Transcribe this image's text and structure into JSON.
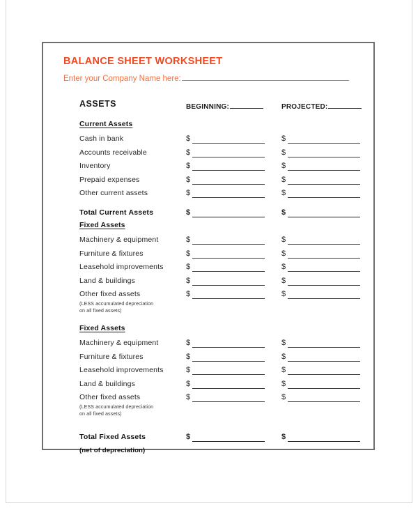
{
  "document": {
    "title": "BALANCE SHEET WORKSHEET",
    "company_prompt": "Enter your Company Name here:",
    "section_heading": "ASSETS",
    "accent_color": "#ef4a23",
    "subtitle_color": "#f4713f"
  },
  "columns": [
    {
      "id": "beginning",
      "label": "BEGINNING:"
    },
    {
      "id": "projected",
      "label": "PROJECTED:"
    }
  ],
  "currency_symbol": "$",
  "groups": [
    {
      "id": "current-assets",
      "title": "Current Assets",
      "rows": [
        {
          "label": "Cash in bank",
          "total": false
        },
        {
          "label": "Accounts receivable",
          "total": false
        },
        {
          "label": "Inventory",
          "total": false
        },
        {
          "label": "Prepaid expenses",
          "total": false
        },
        {
          "label": "Other current assets",
          "total": false
        },
        {
          "label": "Total Current Assets",
          "total": true
        }
      ]
    },
    {
      "id": "fixed-assets-1",
      "title": "Fixed Assets",
      "rows": [
        {
          "label": "Machinery & equipment",
          "total": false
        },
        {
          "label": "Furniture & fixtures",
          "total": false
        },
        {
          "label": "Leasehold improvements",
          "total": false
        },
        {
          "label": "Land & buildings",
          "total": false
        },
        {
          "label": "Other fixed assets",
          "total": false
        }
      ],
      "note_line_1": "(LESS accumulated depreciation",
      "note_line_2": "on all fixed assets)"
    },
    {
      "id": "fixed-assets-2",
      "title": "Fixed Assets",
      "rows": [
        {
          "label": "Machinery & equipment",
          "total": false
        },
        {
          "label": "Furniture & fixtures",
          "total": false
        },
        {
          "label": "Leasehold improvements",
          "total": false
        },
        {
          "label": "Land & buildings",
          "total": false
        },
        {
          "label": "Other fixed assets",
          "total": false
        }
      ],
      "note_line_1": "(LESS accumulated depreciation",
      "note_line_2": "on all fixed assets)",
      "total_row": {
        "label": "Total Fixed Assets",
        "subnote": "(net of depreciation)"
      }
    }
  ]
}
